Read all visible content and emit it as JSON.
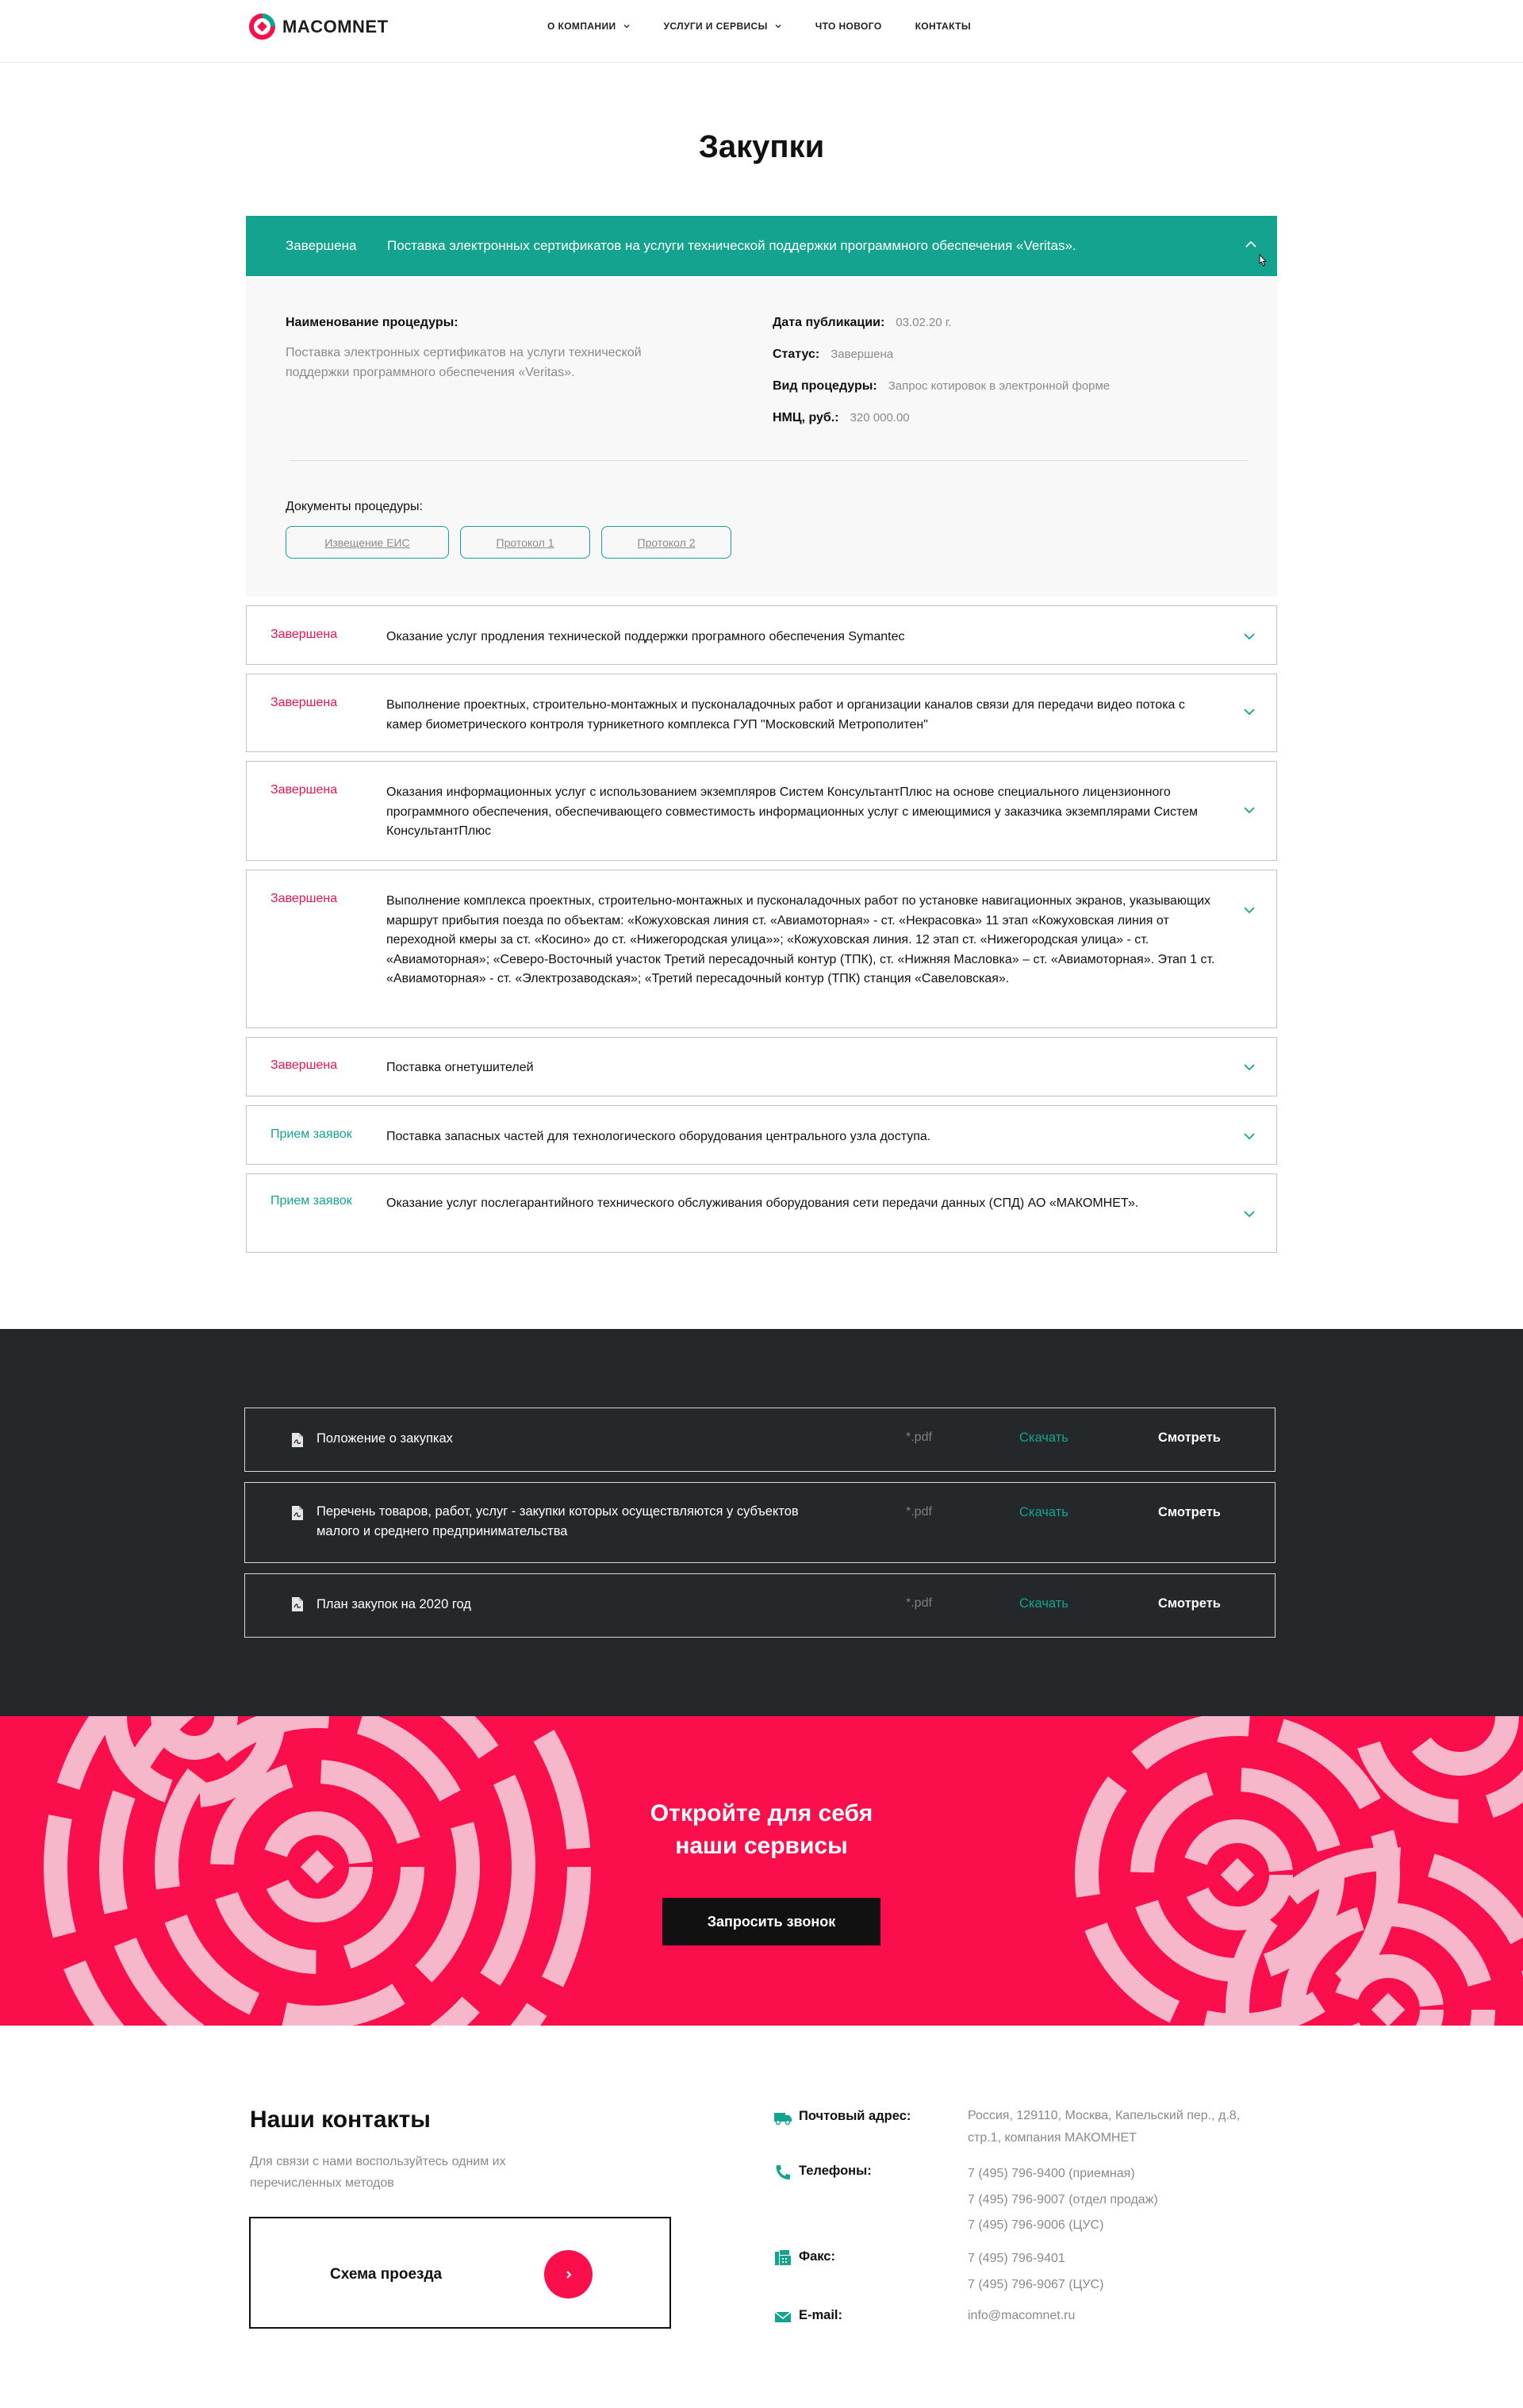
{
  "header": {
    "brand": "MACOMNET",
    "nav": [
      {
        "label": "О КОМПАНИИ",
        "has_dropdown": true
      },
      {
        "label": "УСЛУГИ И СЕРВИСЫ",
        "has_dropdown": true
      },
      {
        "label": "ЧТО НОВОГО",
        "has_dropdown": false
      },
      {
        "label": "КОНТАКТЫ",
        "has_dropdown": false
      }
    ]
  },
  "page_title": "Закупки",
  "expanded": {
    "status": "Завершена",
    "title": "Поставка электронных сертификатов на услуги технической поддержки программного обеспечения «Veritas».",
    "name_label": "Наименование процедуры:",
    "name_value": "Поставка электронных сертификатов на услуги технической поддержки программного обеспечения «Veritas».",
    "pub_label": "Дата публикации:",
    "pub_value": "03.02.20 г.",
    "status_label": "Статус:",
    "status_value": "Завершена",
    "type_label": "Вид процедуры:",
    "type_value": "Запрос котировок в электронной форме",
    "nmc_label": "НМЦ, руб.:",
    "nmc_value": "320 000.00",
    "docs_label": "Документы процедуры:",
    "docs": [
      "Извещение ЕИС",
      "Протокол 1",
      "Протокол 2"
    ]
  },
  "procurements": [
    {
      "status": "Завершена",
      "state": "done",
      "title": "Оказание услуг продления технической поддержки програмного обеспечения Symantec"
    },
    {
      "status": "Завершена",
      "state": "done",
      "title": "Выполнение проектных, строительно-монтажных и пусконаладочных работ и организации каналов связи для передачи видео потока с камер биометрического контроля турникетного комплекса ГУП \"Московский Метрополитен\""
    },
    {
      "status": "Завершена",
      "state": "done",
      "title": "Оказания информационных услуг с использованием экземпляров Систем КонсультантПлюс на основе специального лицензионного программного обеспечения, обеспечивающего совместимость информационных услуг с имеющимися у заказчика экземплярами Систем КонсультантПлюс"
    },
    {
      "status": "Завершена",
      "state": "done",
      "title": "Выполнение комплекса проектных, строительно-монтажных и пусконаладочных работ по установке навигационных экранов, указывающих маршрут прибытия поезда по объектам: «Кожуховская линия ст. «Авиамоторная» - ст. «Некрасовка» 11 этап «Кожуховская линия от переходной кмеры за ст. «Косино» до ст. «Нижегородская улица»»; «Кожуховская линия. 12 этап ст. «Нижегородская улица» - ст. «Авиамоторная»; «Северо-Восточный участок Третий пересадочный контур (ТПК), ст. «Нижняя Масловка» – ст. «Авиамоторная». Этап 1 ст. «Авиамоторная» - ст. «Электрозаводская»; «Третий пересадочный контур (ТПК) станция «Савеловская»."
    },
    {
      "status": "Завершена",
      "state": "done",
      "title": "Поставка огнетушителей"
    },
    {
      "status": "Прием заявок",
      "state": "open",
      "title": "Поставка запасных частей для технологического оборудования центрального узла доступа."
    },
    {
      "status": "Прием заявок",
      "state": "open",
      "title": "Оказание услуг послегарантийного технического обслуживания оборудования сети передачи данных (СПД) АО «МАКОМНЕТ»."
    }
  ],
  "documents": [
    {
      "name": "Положение о закупках",
      "ext": "*.pdf",
      "download": "Скачать",
      "view": "Смотреть"
    },
    {
      "name": "Перечень товаров, работ, услуг - закупки которых осуществляются у субъектов малого и среднего предпринимательства",
      "ext": "*.pdf",
      "download": "Скачать",
      "view": "Смотреть"
    },
    {
      "name": "План закупок на 2020 год",
      "ext": "*.pdf",
      "download": "Скачать",
      "view": "Смотреть"
    }
  ],
  "promo": {
    "title_line1": "Откройте для себя",
    "title_line2": "наши сервисы",
    "button": "Запросить звонок"
  },
  "contacts": {
    "title": "Наши контакты",
    "subtitle": "Для связи с нами воспользуйтесь одним их перечисленных методов",
    "route": "Схема проезда",
    "address_label": "Почтовый адрес:",
    "address_line1": "Россия, 129110, Москва, Капельский пер., д.8,",
    "address_line2": "стр.1, компания МАКОМНЕТ",
    "phones_label": "Телефоны:",
    "phones": [
      "7 (495) 796-9400 (приемная)",
      "7 (495) 796-9007 (отдел продаж)",
      "7 (495) 796-9006 (ЦУС)"
    ],
    "fax_label": "Факс:",
    "fax": [
      "7 (495) 796-9401",
      "7 (495) 796-9067 (ЦУС)"
    ],
    "email_label": "E-mail:",
    "email": "info@macomnet.ru"
  },
  "colors": {
    "teal": "#14a38f",
    "red": "#fa0e4b",
    "dark": "#25282b"
  }
}
